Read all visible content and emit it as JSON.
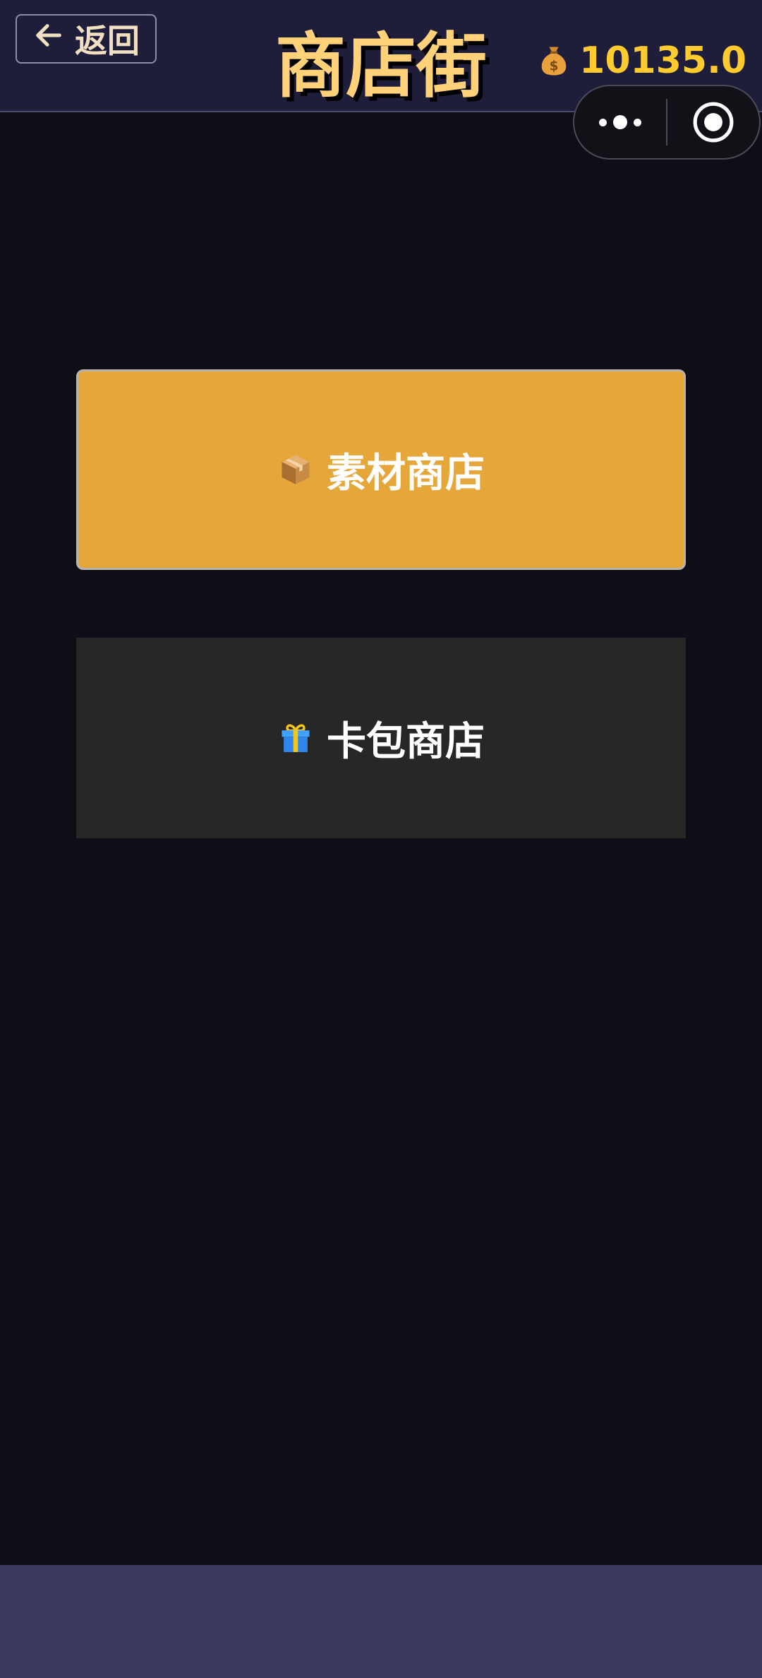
{
  "header": {
    "back_label": "返回",
    "title": "商店街",
    "coins": "10135.0",
    "coin_icon": "money-bag-icon"
  },
  "capsule": {
    "more_icon": "more-dots-icon",
    "close_icon": "target-close-icon"
  },
  "shops": {
    "material": {
      "icon": "package-icon",
      "label": "素材商店"
    },
    "cardpack": {
      "icon": "gift-icon",
      "label": "卡包商店"
    }
  },
  "colors": {
    "header_bg": "#1e1d3a",
    "page_bg": "#0f0e17",
    "title": "#ffd27a",
    "coins": "#ffcb2e",
    "material_button": "#e6a73a",
    "cardpack_button": "#272727",
    "footer": "#3b3a5f"
  }
}
